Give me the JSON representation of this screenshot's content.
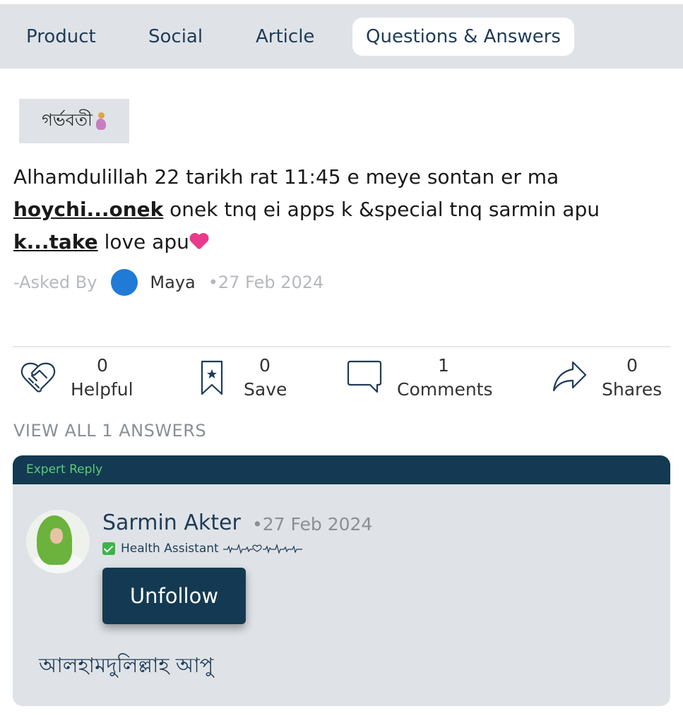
{
  "tabs": [
    {
      "label": "Product"
    },
    {
      "label": "Social"
    },
    {
      "label": "Article"
    },
    {
      "label": "Questions & Answers",
      "active": true
    }
  ],
  "question": {
    "tag": "গর্ভবতী",
    "tag_icon": "pregnant-woman-icon",
    "text_part1": "Alhamdulillah 22 tarikh rat 11:45 e meye sontan er ma ",
    "text_bold1": "hoychi...onek",
    "text_part2": " onek tnq ei apps k &special tnq sarmin apu ",
    "text_bold2": "k...take",
    "text_part3": " love apu",
    "asked_by_label": "-Asked By",
    "author": "Maya",
    "date": "•27 Feb 2024"
  },
  "actions": {
    "helpful": {
      "count": "0",
      "label": "Helpful"
    },
    "save": {
      "count": "0",
      "label": "Save"
    },
    "comments": {
      "count": "1",
      "label": "Comments"
    },
    "shares": {
      "count": "0",
      "label": "Shares"
    }
  },
  "view_all_label": "VIEW ALL 1 ANSWERS",
  "answer": {
    "header": "Expert Reply",
    "name": "Sarmin Akter",
    "date": "•27 Feb 2024",
    "role": "Health Assistant",
    "unfollow_label": "Unfollow",
    "text": "আলহামদুলিল্লাহ আপু"
  },
  "colors": {
    "primary": "#133a52",
    "tab_bg": "#dfe3e7",
    "expert_green": "#5ccc7a",
    "avatar_blue": "#1f7bd6"
  }
}
